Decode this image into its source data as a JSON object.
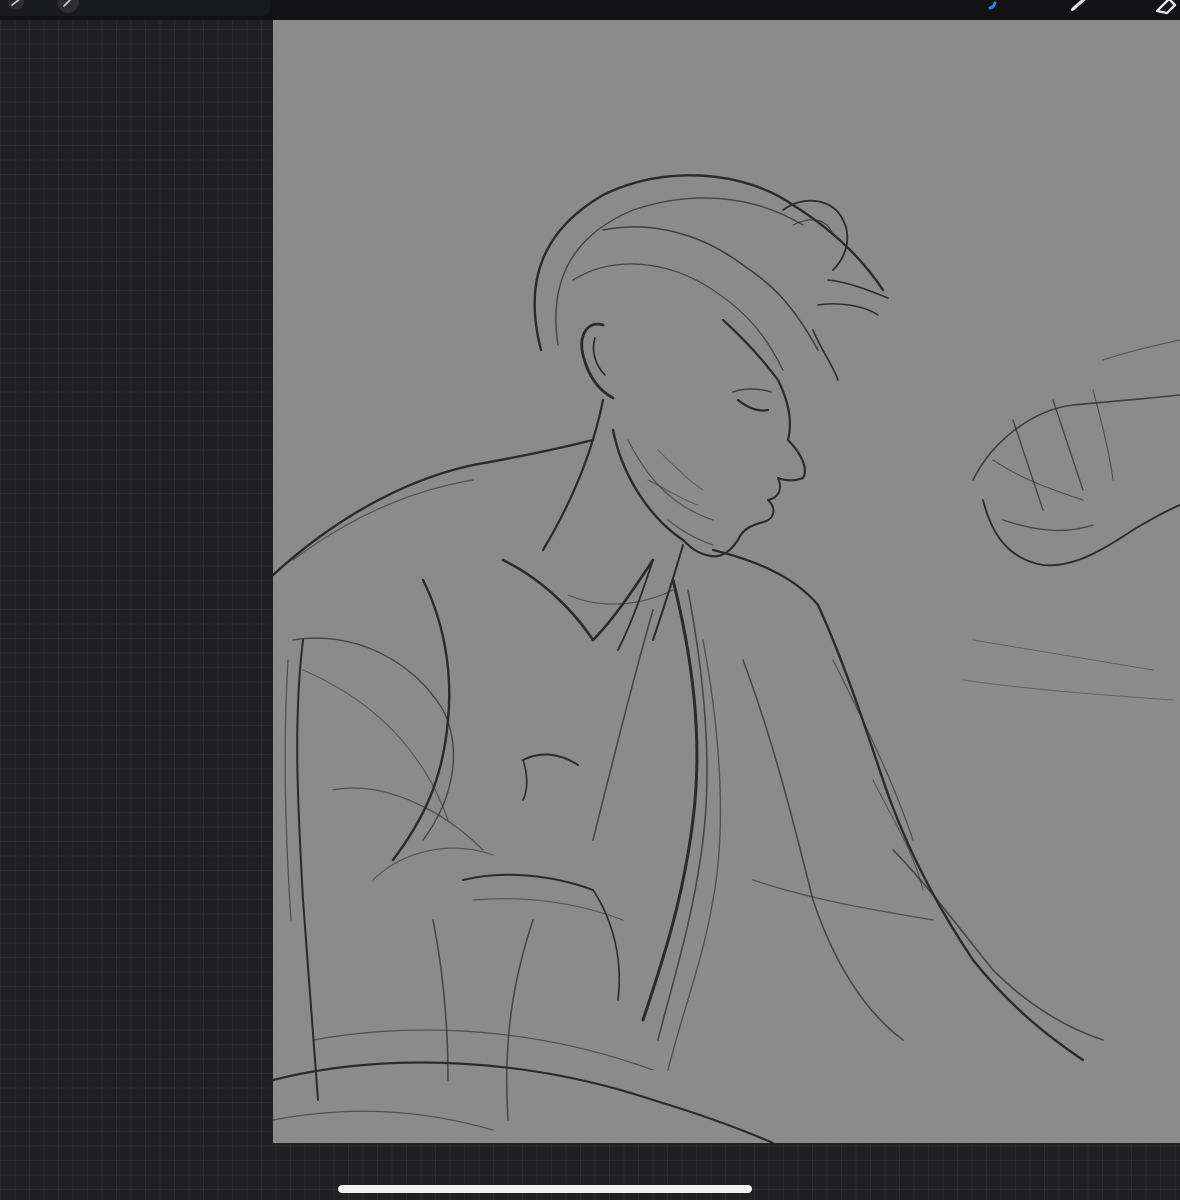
{
  "app": {
    "name": "drawing-canvas-view"
  },
  "toolbar": {
    "left_tools": [
      {
        "name": "actions-icon"
      },
      {
        "name": "adjustments-icon"
      }
    ],
    "right_tools": [
      {
        "name": "color-indicator-icon",
        "color": "#2f7cf6"
      },
      {
        "name": "brush-icon"
      },
      {
        "name": "eraser-icon"
      }
    ]
  },
  "canvas": {
    "background": "#8b8b8b",
    "stroke_color": "#2a2a2a"
  },
  "colors": {
    "workspace": "#202022",
    "accent": "#2f7cf6",
    "home_indicator": "#f2f2f2"
  }
}
